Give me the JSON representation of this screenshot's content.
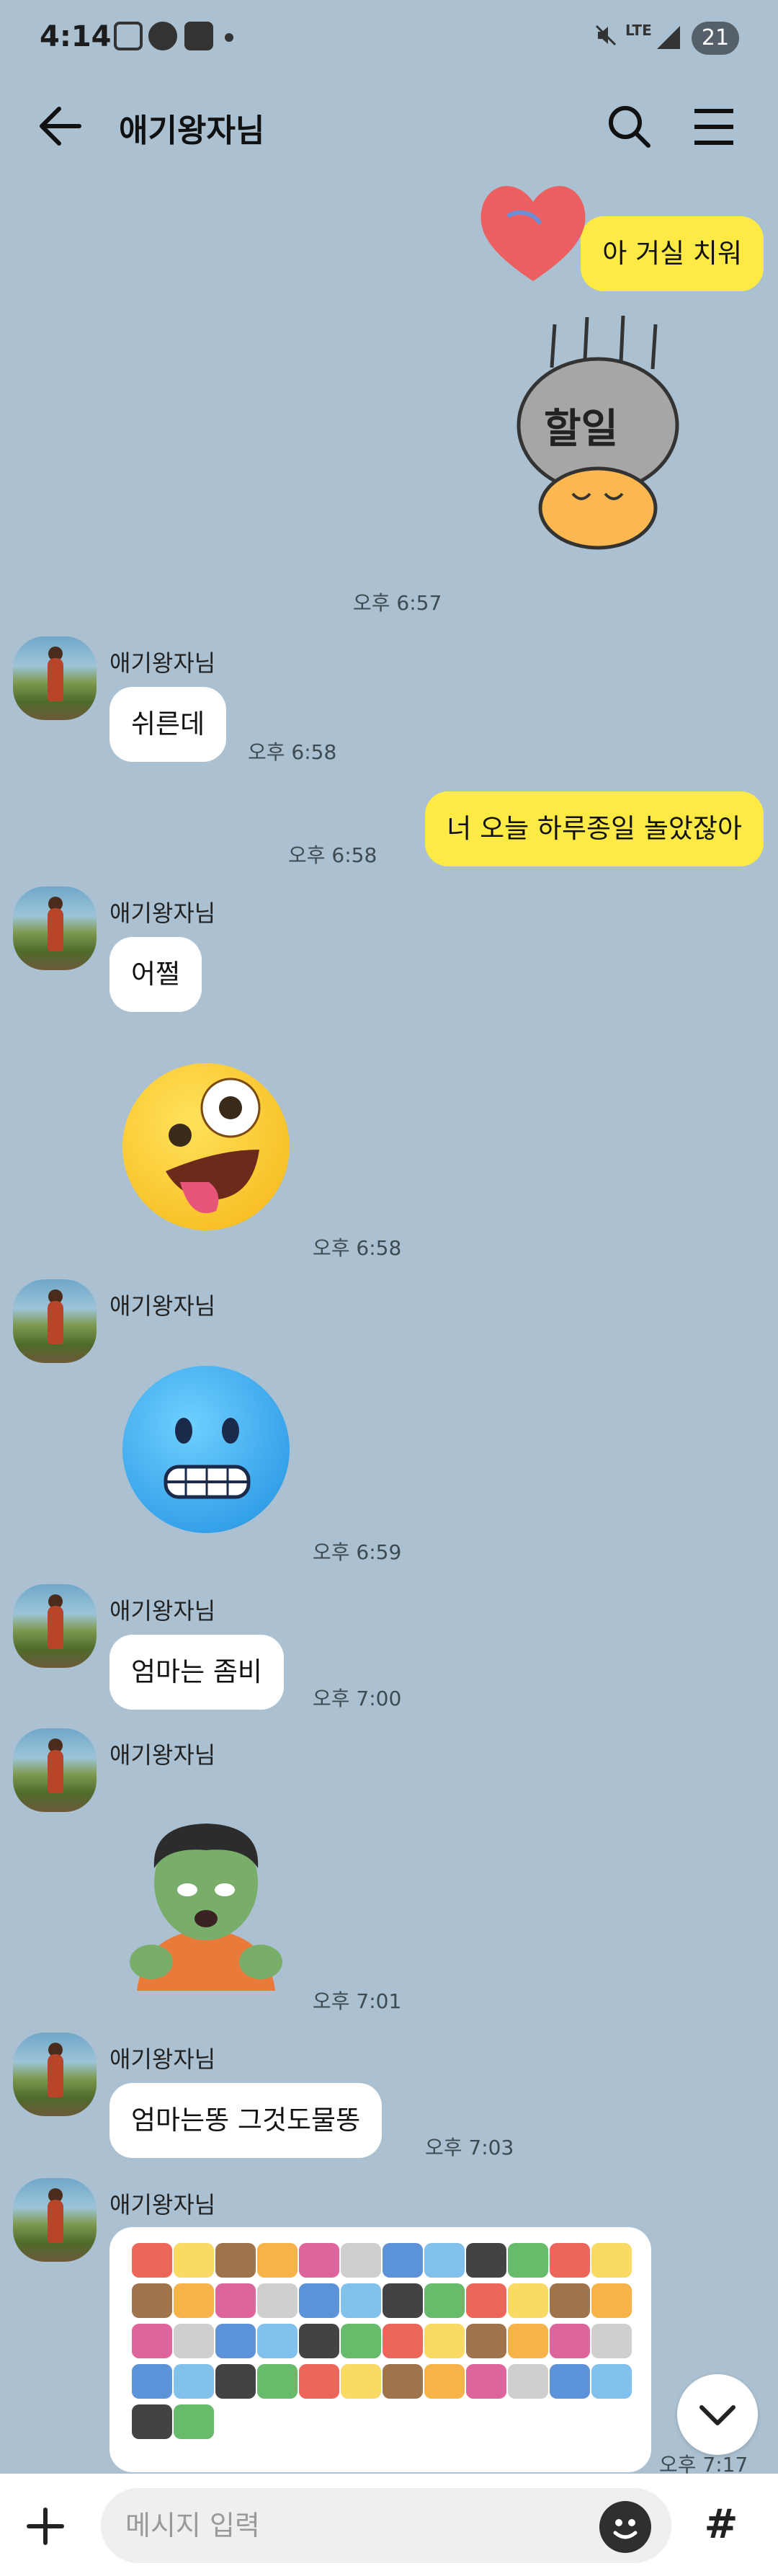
{
  "status_bar": {
    "time": "4:14",
    "battery": "21",
    "network": "LTE"
  },
  "header": {
    "title": "애기왕자님"
  },
  "messages": {
    "m1": {
      "text": "아 거실 치워"
    },
    "sticker_text": "할일",
    "t1": "오후 6:57",
    "sender": "애기왕자님",
    "m2": {
      "text": "쉬른데",
      "time": "오후 6:58"
    },
    "m3": {
      "text": "너 오늘 하루종일 놀았잖아",
      "time": "오후 6:58"
    },
    "m4": {
      "text": "어쩔"
    },
    "t_zany": "오후 6:58",
    "t_cold": "오후 6:59",
    "m5": {
      "text": "엄마는 좀비",
      "time": "오후 7:00"
    },
    "t_zombie": "오후 7:01",
    "m6": {
      "text": "엄마는똥 그것도물똥",
      "time": "오후 7:03"
    },
    "t_grid": "오후 7:17"
  },
  "composer": {
    "placeholder": "메시지 입력",
    "hash": "#"
  },
  "icons": [
    "back-arrow-icon",
    "search-icon",
    "menu-icon",
    "plus-icon",
    "emoji-icon",
    "chevron-down-icon"
  ],
  "colors": {
    "background": "#abc1d1",
    "outgoing_bubble": "#fdea44",
    "incoming_bubble": "#ffffff"
  }
}
